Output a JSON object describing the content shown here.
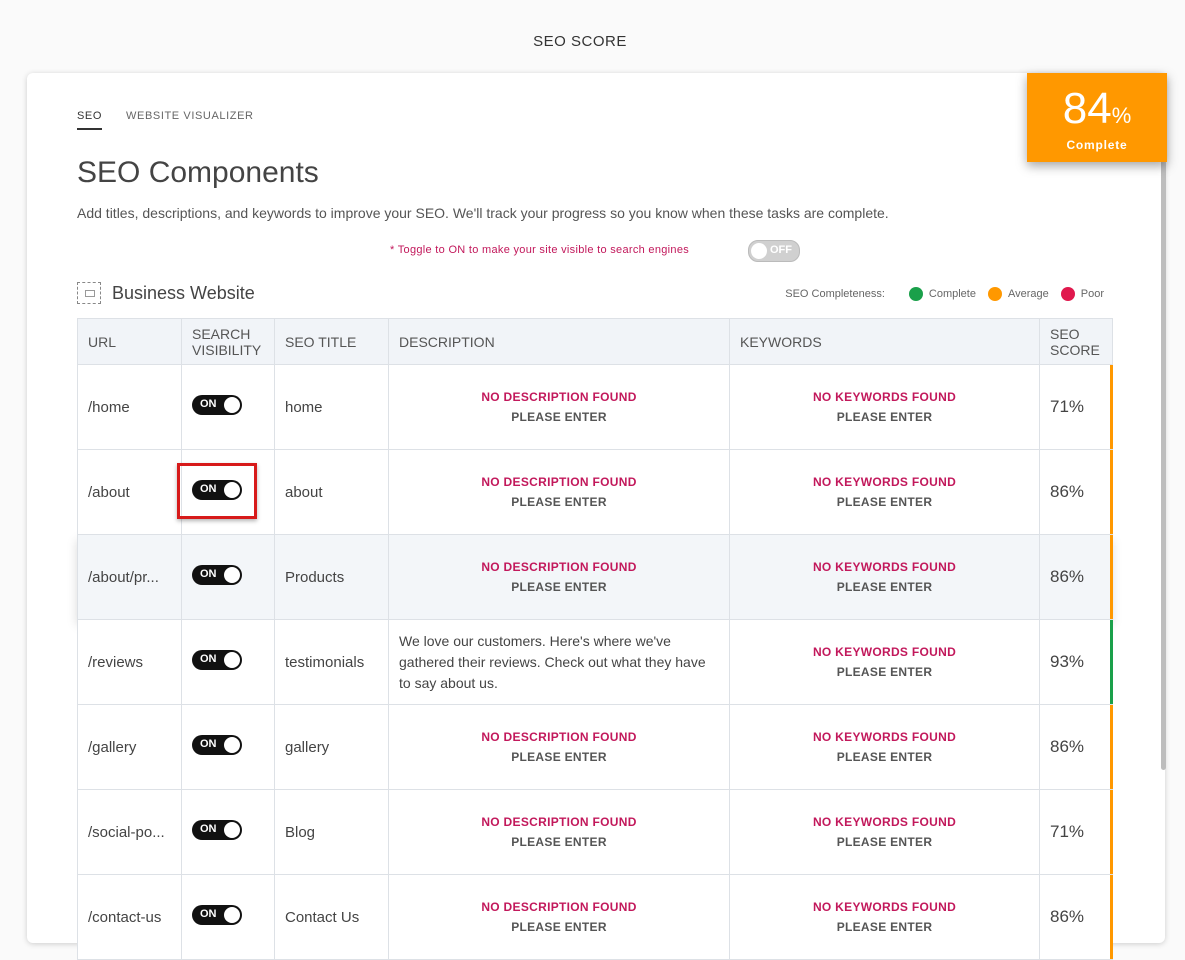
{
  "page_title": "SEO SCORE",
  "score_badge": {
    "value": "84",
    "unit": "%",
    "label": "Complete",
    "color": "#ff9800"
  },
  "tabs": [
    {
      "label": "SEO",
      "active": true
    },
    {
      "label": "WEBSITE VISUALIZER",
      "active": false
    }
  ],
  "heading": "SEO Components",
  "subtitle": "Add titles, descriptions, and keywords to improve your SEO. We'll track your progress so you know when these tasks are complete.",
  "visibility_hint": "* Toggle to ON to make your site visible to search engines",
  "global_toggle": {
    "label": "OFF",
    "state": false
  },
  "site": {
    "name": "Business Website",
    "icon": "website-icon"
  },
  "legend": {
    "label": "SEO Completeness:",
    "items": [
      {
        "label": "Complete",
        "color": "#1aa04a"
      },
      {
        "label": "Average",
        "color": "#ff9800"
      },
      {
        "label": "Poor",
        "color": "#e0184d"
      }
    ]
  },
  "table": {
    "headers": {
      "url": "URL",
      "visibility_line1": "SEARCH",
      "visibility_line2": "VISIBILITY",
      "title": "SEO TITLE",
      "description": "DESCRIPTION",
      "keywords": "KEYWORDS",
      "score_line1": "SEO",
      "score_line2": "SCORE"
    },
    "missing_description": "NO DESCRIPTION FOUND",
    "missing_keywords": "NO KEYWORDS FOUND",
    "please_enter": "PLEASE ENTER",
    "rows": [
      {
        "url": "/home",
        "visibility": "ON",
        "title": "home",
        "description": "",
        "keywords": "",
        "score": "71%",
        "status_color": "#ff9800"
      },
      {
        "url": "/about",
        "visibility": "ON",
        "title": "about",
        "description": "",
        "keywords": "",
        "score": "86%",
        "status_color": "#ff9800"
      },
      {
        "url": "/about/pr...",
        "visibility": "ON",
        "title": "Products",
        "description": "",
        "keywords": "",
        "score": "86%",
        "status_color": "#ff9800"
      },
      {
        "url": "/reviews",
        "visibility": "ON",
        "title": "testimonials",
        "description": "We love our customers. Here's where we've gathered their reviews. Check out what they have to say about us.",
        "keywords": "",
        "score": "93%",
        "status_color": "#1aa04a"
      },
      {
        "url": "/gallery",
        "visibility": "ON",
        "title": "gallery",
        "description": "",
        "keywords": "",
        "score": "86%",
        "status_color": "#ff9800"
      },
      {
        "url": "/social-po...",
        "visibility": "ON",
        "title": "Blog",
        "description": "",
        "keywords": "",
        "score": "71%",
        "status_color": "#ff9800"
      },
      {
        "url": "/contact-us",
        "visibility": "ON",
        "title": "Contact Us",
        "description": "",
        "keywords": "",
        "score": "86%",
        "status_color": "#ff9800"
      }
    ]
  }
}
